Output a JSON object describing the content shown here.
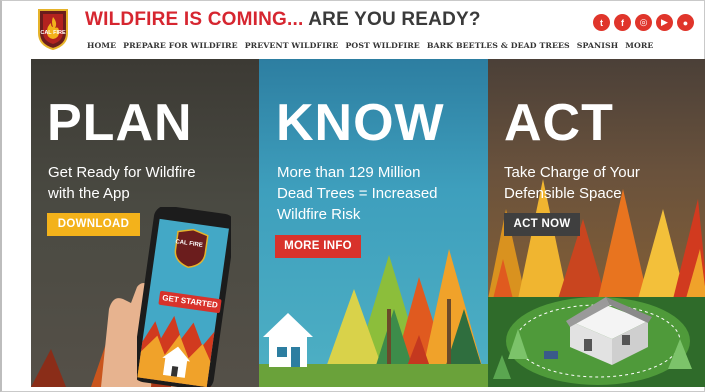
{
  "header": {
    "headline_red": "WILDFIRE IS COMING...",
    "headline_dark": "ARE YOU READY?",
    "logo_text": "CAL FIRE"
  },
  "nav": {
    "items": [
      "HOME",
      "PREPARE FOR WILDFIRE",
      "PREVENT WILDFIRE",
      "POST WILDFIRE",
      "BARK BEETLES & DEAD TREES",
      "SPANISH",
      "MORE"
    ]
  },
  "social": {
    "icons": [
      "twitter-icon",
      "facebook-icon",
      "instagram-icon",
      "youtube-icon",
      "location-icon"
    ],
    "glyphs": [
      "t",
      "f",
      "◎",
      "▶",
      "●"
    ],
    "color": "#e0352b"
  },
  "panels": {
    "plan": {
      "title": "PLAN",
      "line1": "Get Ready for Wildfire",
      "line2": "with the App",
      "button": "DOWNLOAD",
      "phone_button": "GET STARTED",
      "phone_logo": "CAL FIRE"
    },
    "know": {
      "title": "KNOW",
      "line1": "More than 129 Million",
      "line2": "Dead Trees = Increased",
      "line3": "Wildfire Risk",
      "button": "MORE INFO"
    },
    "act": {
      "title": "ACT",
      "line1": "Take Charge of Your",
      "line2": "Defensible Space",
      "button": "ACT NOW"
    }
  },
  "colors": {
    "brand_red": "#d62630",
    "yellow_button": "#f3b21b",
    "red_button": "#d8322b",
    "dark_button": "#3f3f3f"
  }
}
